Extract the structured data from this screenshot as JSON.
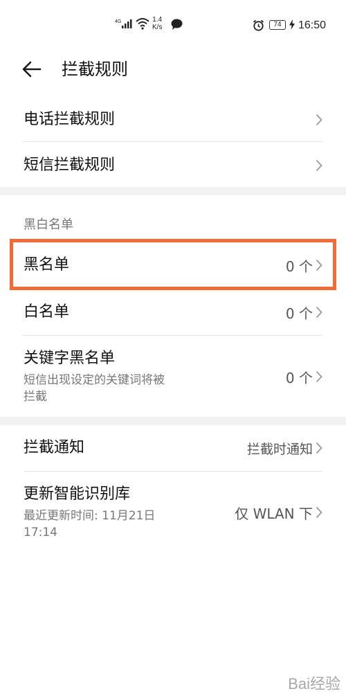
{
  "status_bar": {
    "net_type": "4G",
    "speed_value": "1.4",
    "speed_unit": "K/s",
    "battery": "74",
    "time": "16:50"
  },
  "header": {
    "title": "拦截规则"
  },
  "rules": [
    {
      "label": "电话拦截规则"
    },
    {
      "label": "短信拦截规则"
    }
  ],
  "lists_section": {
    "title": "黑白名单",
    "items": [
      {
        "label": "黑名单",
        "value": "0 个"
      },
      {
        "label": "白名单",
        "value": "0 个"
      },
      {
        "label": "关键字黑名单",
        "subtitle": "短信出现设定的关键词将被拦截",
        "subtitle_line1": "短信出现设定的关键词将被",
        "subtitle_line2": "拦截",
        "value": "0 个"
      }
    ]
  },
  "other_settings": [
    {
      "label": "拦截通知",
      "value": "拦截时通知"
    },
    {
      "label": "更新智能识别库",
      "subtitle_line1": "最近更新时间: 11月21日",
      "subtitle_line2": "17:14",
      "value": "仅 WLAN 下"
    }
  ],
  "watermark": "Bai经验"
}
